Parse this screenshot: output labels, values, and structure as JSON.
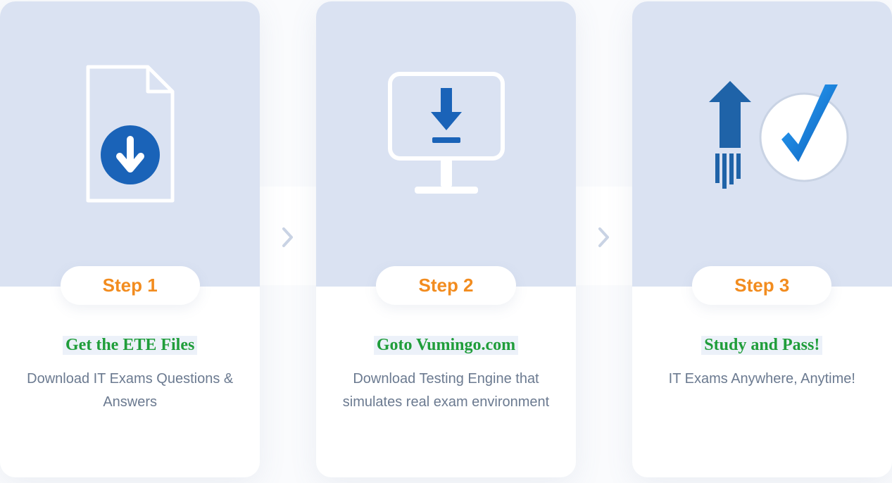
{
  "steps": [
    {
      "pill": "Step 1",
      "title": "Get the ETE Files",
      "desc": "Download IT Exams Questions & Answers"
    },
    {
      "pill": "Step 2",
      "title": "Goto Vumingo.com",
      "desc": "Download Testing Engine that simulates real exam environment"
    },
    {
      "pill": "Step 3",
      "title": "Study and Pass!",
      "desc": "IT Exams Anywhere, Anytime!"
    }
  ]
}
